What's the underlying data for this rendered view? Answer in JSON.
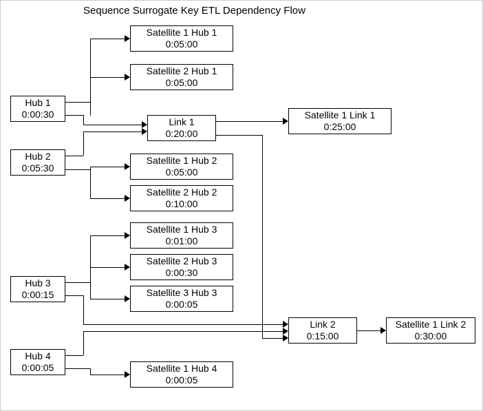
{
  "title": "Sequence Surrogate Key ETL Dependency Flow",
  "nodes": {
    "hub1": {
      "label": "Hub 1",
      "time": "0:00:30"
    },
    "hub2": {
      "label": "Hub 2",
      "time": "0:05:30"
    },
    "hub3": {
      "label": "Hub 3",
      "time": "0:00:15"
    },
    "hub4": {
      "label": "Hub 4",
      "time": "0:00:05"
    },
    "sat1hub1": {
      "label": "Satellite 1 Hub 1",
      "time": "0:05:00"
    },
    "sat2hub1": {
      "label": "Satellite 2 Hub 1",
      "time": "0:05:00"
    },
    "sat1hub2": {
      "label": "Satellite 1 Hub 2",
      "time": "0:05:00"
    },
    "sat2hub2": {
      "label": "Satellite 2 Hub 2",
      "time": "0:10:00"
    },
    "sat1hub3": {
      "label": "Satellite 1 Hub 3",
      "time": "0:01:00"
    },
    "sat2hub3": {
      "label": "Satellite 2 Hub 3",
      "time": "0:00:30"
    },
    "sat3hub3": {
      "label": "Satellite 3 Hub 3",
      "time": "0:00:05"
    },
    "sat1hub4": {
      "label": "Satellite 1 Hub 4",
      "time": "0:00:05"
    },
    "link1": {
      "label": "Link 1",
      "time": "0:20:00"
    },
    "link2": {
      "label": "Link 2",
      "time": "0:15:00"
    },
    "sat1link1": {
      "label": "Satellite 1 Link 1",
      "time": "0:25:00"
    },
    "sat1link2": {
      "label": "Satellite 1 Link 2",
      "time": "0:30:00"
    }
  }
}
